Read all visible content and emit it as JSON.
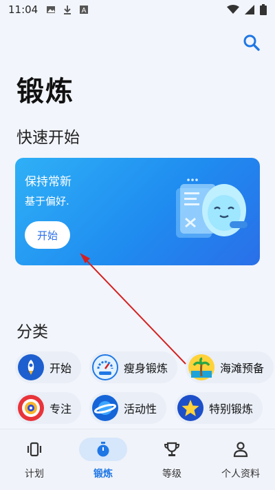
{
  "status_bar": {
    "time": "11:04",
    "left_icons": [
      "image-icon",
      "download-icon",
      "text-icon"
    ],
    "right_icons": [
      "wifi-icon",
      "signal-icon",
      "battery-icon"
    ]
  },
  "header": {
    "title": "锻炼",
    "search_icon": "search-icon"
  },
  "quick_start": {
    "section_title": "快速开始",
    "card": {
      "title": "保持常新",
      "subtitle": "基于偏好.",
      "button_label": "开始",
      "illustration": "robot-illustration"
    }
  },
  "categories": {
    "section_title": "分类",
    "row1": [
      {
        "label": "开始",
        "icon": "rocket-icon"
      },
      {
        "label": "瘦身锻炼",
        "icon": "scale-icon"
      },
      {
        "label": "海滩预备",
        "icon": "palm-tree-icon"
      }
    ],
    "row2": [
      {
        "label": "专注",
        "icon": "target-icon"
      },
      {
        "label": "活动性",
        "icon": "planet-icon"
      },
      {
        "label": "特别锻炼",
        "icon": "star-icon"
      }
    ]
  },
  "bottom_nav": {
    "items": [
      {
        "label": "计划",
        "icon": "vibrate-icon",
        "active": false
      },
      {
        "label": "锻炼",
        "icon": "stopwatch-icon",
        "active": true
      },
      {
        "label": "等级",
        "icon": "trophy-icon",
        "active": false
      },
      {
        "label": "个人资料",
        "icon": "person-icon",
        "active": false
      }
    ]
  },
  "colors": {
    "accent": "#1f77e5",
    "card_gradient_start": "#2fb0f6",
    "card_gradient_end": "#2a6fe8",
    "annotation_arrow": "#d42020"
  }
}
